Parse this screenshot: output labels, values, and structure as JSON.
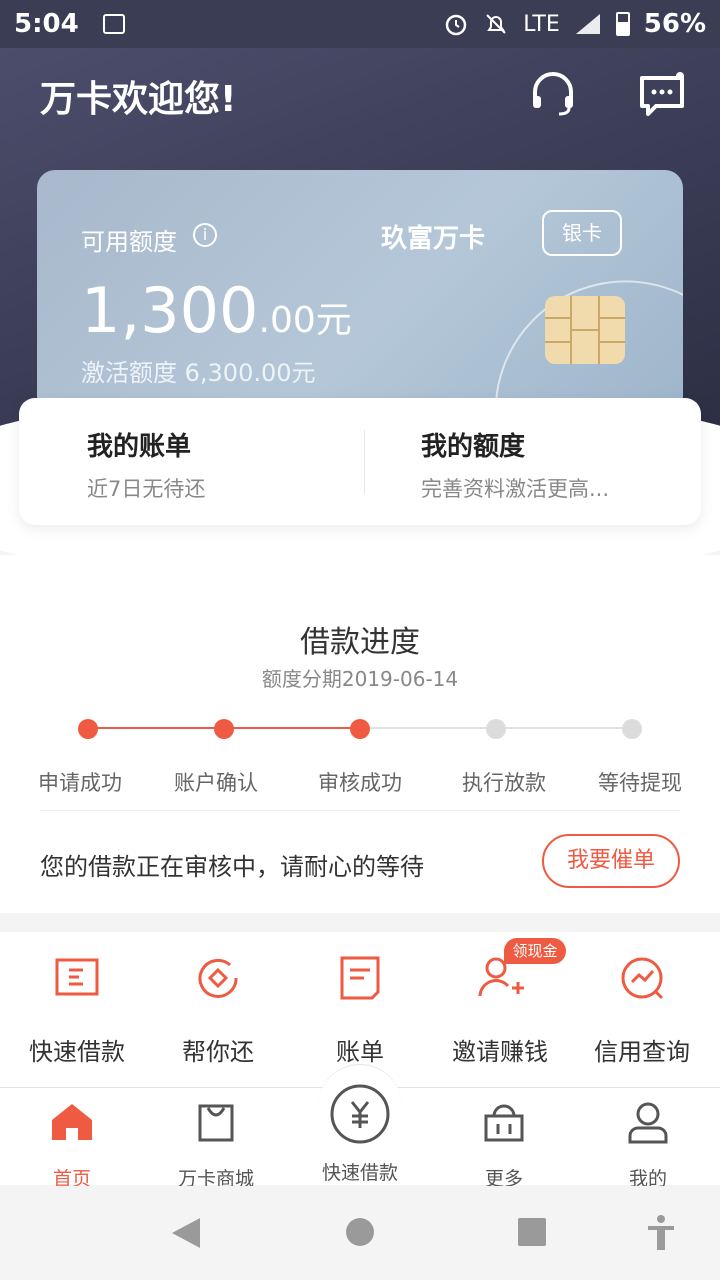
{
  "status_bar": {
    "time": "5:04",
    "network": "LTE",
    "battery": "56%"
  },
  "header": {
    "welcome": "万卡欢迎您!",
    "icons": [
      "headset-icon",
      "message-icon"
    ]
  },
  "card": {
    "available_label": "可用额度",
    "brand": "玖富万卡",
    "tier": "银卡",
    "amount_int": "1,300",
    "amount_dec": ".00元",
    "activate_text": "激活额度 6,300.00元"
  },
  "panel": {
    "bill_title": "我的账单",
    "bill_sub": "近7日无待还",
    "limit_title": "我的额度",
    "limit_sub": "完善资料激活更高..."
  },
  "progress": {
    "title": "借款进度",
    "subtitle": "额度分期2019-06-14",
    "steps": [
      {
        "label": "申请成功",
        "done": true
      },
      {
        "label": "账户确认",
        "done": true
      },
      {
        "label": "审核成功",
        "done": true
      },
      {
        "label": "执行放款",
        "done": false
      },
      {
        "label": "等待提现",
        "done": false
      }
    ],
    "message": "您的借款正在审核中，请耐心的等待",
    "urge_button": "我要催单",
    "accent": "#ef5a42"
  },
  "shortcuts": {
    "items": [
      {
        "label": "快速借款",
        "icon": "quick-loan-icon"
      },
      {
        "label": "帮你还",
        "icon": "help-repay-icon"
      },
      {
        "label": "账单",
        "icon": "bill-icon"
      },
      {
        "label": "邀请赚钱",
        "icon": "invite-icon"
      },
      {
        "label": "信用查询",
        "icon": "credit-query-icon"
      }
    ],
    "badge": "领现金"
  },
  "bottom_nav": {
    "items": [
      {
        "label": "首页",
        "icon": "home-icon",
        "active": true
      },
      {
        "label": "万卡商城",
        "icon": "shopping-bag-icon",
        "active": false
      },
      {
        "label": "快速借款",
        "icon": "yuan-icon",
        "active": false
      },
      {
        "label": "更多",
        "icon": "basket-icon",
        "active": false
      },
      {
        "label": "我的",
        "icon": "user-icon",
        "active": false
      }
    ]
  }
}
